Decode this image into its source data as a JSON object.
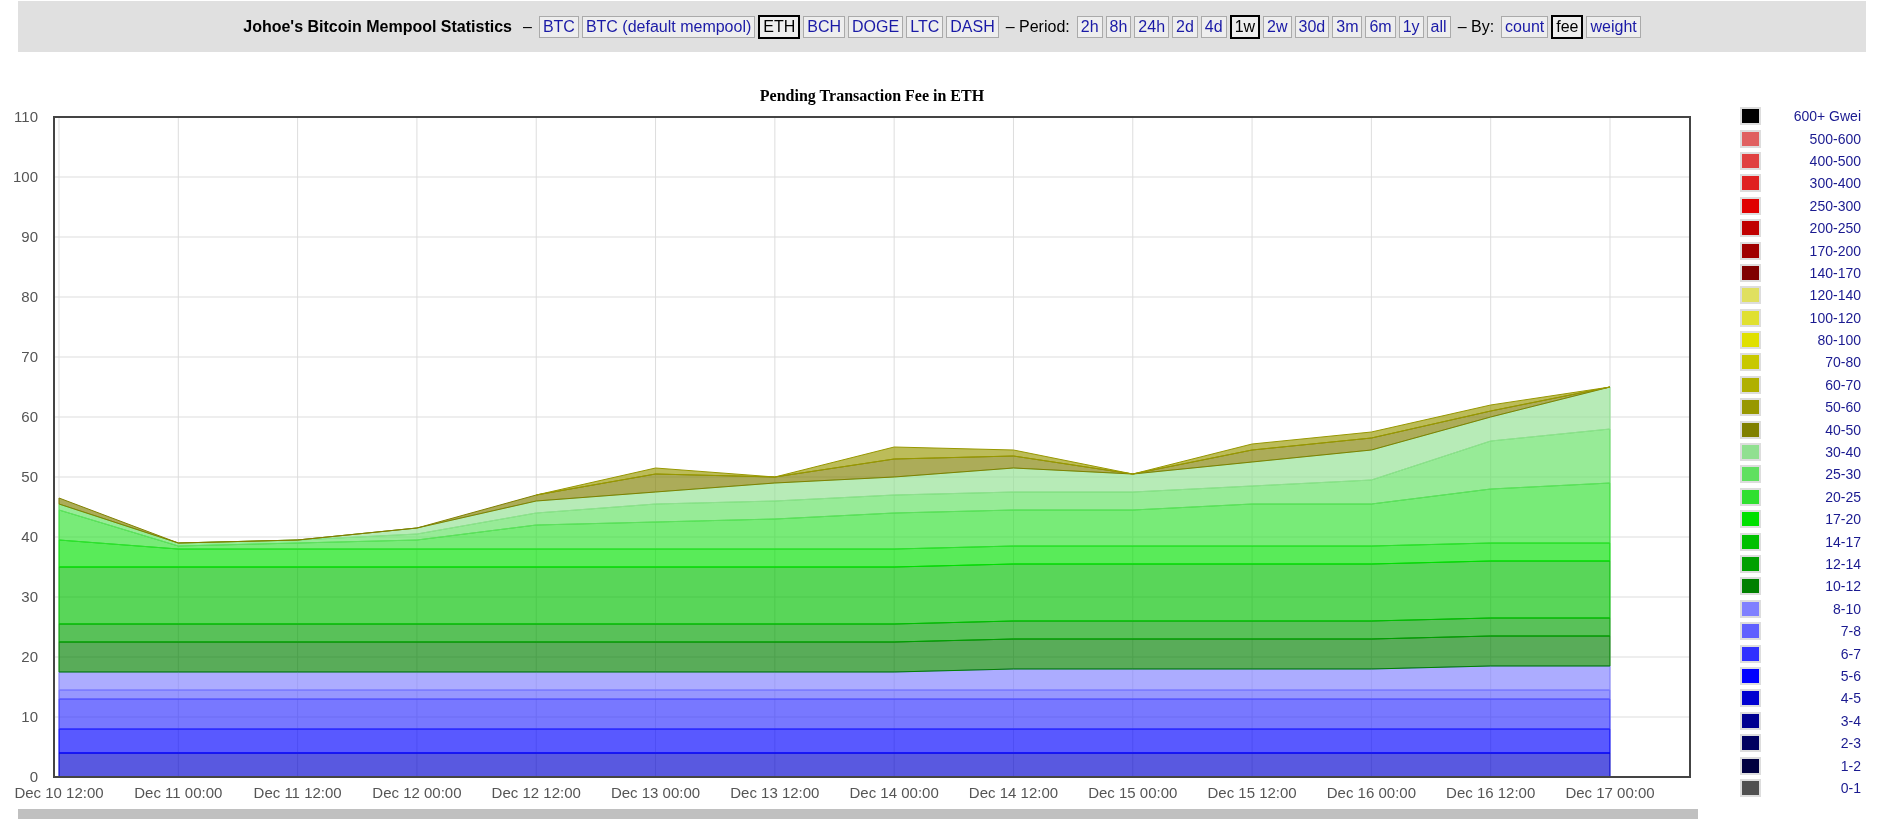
{
  "header": {
    "title": "Johoe's Bitcoin Mempool Statistics",
    "title_separator": "–",
    "coins": [
      {
        "label": "BTC",
        "selected": false
      },
      {
        "label": "BTC (default mempool)",
        "selected": false
      },
      {
        "label": "ETH",
        "selected": true
      },
      {
        "label": "BCH",
        "selected": false
      },
      {
        "label": "DOGE",
        "selected": false
      },
      {
        "label": "LTC",
        "selected": false
      },
      {
        "label": "DASH",
        "selected": false
      }
    ],
    "period_label": "– Period:",
    "periods": [
      {
        "label": "2h",
        "selected": false
      },
      {
        "label": "8h",
        "selected": false
      },
      {
        "label": "24h",
        "selected": false
      },
      {
        "label": "2d",
        "selected": false
      },
      {
        "label": "4d",
        "selected": false
      },
      {
        "label": "1w",
        "selected": true
      },
      {
        "label": "2w",
        "selected": false
      },
      {
        "label": "30d",
        "selected": false
      },
      {
        "label": "3m",
        "selected": false
      },
      {
        "label": "6m",
        "selected": false
      },
      {
        "label": "1y",
        "selected": false
      },
      {
        "label": "all",
        "selected": false
      }
    ],
    "by_label": "– By:",
    "by": [
      {
        "label": "count",
        "selected": false
      },
      {
        "label": "fee",
        "selected": true
      },
      {
        "label": "weight",
        "selected": false
      }
    ]
  },
  "chart": {
    "chart_data": {
      "type": "area",
      "stacked": true,
      "grid": true,
      "title": "Pending Transaction Fee in ETH",
      "categories": [
        "Dec 10 12:00",
        "Dec 11 00:00",
        "Dec 11 12:00",
        "Dec 12 00:00",
        "Dec 12 12:00",
        "Dec 13 00:00",
        "Dec 13 12:00",
        "Dec 14 00:00",
        "Dec 14 12:00",
        "Dec 15 00:00",
        "Dec 15 12:00",
        "Dec 16 00:00",
        "Dec 16 12:00",
        "Dec 17 00:00"
      ],
      "ylim": [
        0,
        110
      ],
      "yticks": [
        0,
        10,
        20,
        30,
        40,
        50,
        60,
        70,
        80,
        90,
        100,
        110
      ],
      "series": [
        {
          "name": "600+ Gwei",
          "color": "#000000",
          "values": [
            null,
            null,
            null,
            null,
            null,
            null,
            null,
            null,
            null,
            null,
            null,
            null,
            null,
            null
          ]
        },
        {
          "name": "500-600",
          "color": "#e06060",
          "values": [
            null,
            null,
            null,
            null,
            null,
            null,
            null,
            null,
            null,
            null,
            null,
            null,
            null,
            null
          ]
        },
        {
          "name": "400-500",
          "color": "#e04040",
          "values": [
            null,
            null,
            null,
            null,
            null,
            null,
            null,
            null,
            null,
            null,
            null,
            null,
            null,
            null
          ]
        },
        {
          "name": "300-400",
          "color": "#e02020",
          "values": [
            null,
            null,
            null,
            null,
            null,
            null,
            null,
            null,
            null,
            null,
            null,
            null,
            null,
            null
          ]
        },
        {
          "name": "250-300",
          "color": "#e00000",
          "values": [
            null,
            null,
            null,
            null,
            null,
            null,
            null,
            null,
            null,
            null,
            null,
            null,
            null,
            null
          ]
        },
        {
          "name": "200-250",
          "color": "#c00000",
          "values": [
            null,
            null,
            null,
            null,
            null,
            null,
            null,
            null,
            null,
            null,
            null,
            null,
            null,
            null
          ]
        },
        {
          "name": "170-200",
          "color": "#a00000",
          "values": [
            null,
            null,
            null,
            null,
            null,
            null,
            null,
            null,
            null,
            null,
            null,
            null,
            null,
            null
          ]
        },
        {
          "name": "140-170",
          "color": "#800000",
          "values": [
            null,
            null,
            null,
            null,
            null,
            null,
            null,
            null,
            null,
            null,
            null,
            null,
            null,
            null
          ]
        },
        {
          "name": "120-140",
          "color": "#e0e060",
          "values": [
            null,
            null,
            null,
            null,
            null,
            null,
            null,
            null,
            null,
            null,
            null,
            null,
            null,
            null
          ]
        },
        {
          "name": "100-120",
          "color": "#e0e030",
          "values": [
            null,
            null,
            null,
            null,
            null,
            null,
            null,
            null,
            null,
            null,
            null,
            null,
            null,
            null
          ]
        },
        {
          "name": "80-100",
          "color": "#e0e000",
          "values": [
            null,
            null,
            null,
            null,
            null,
            null,
            null,
            null,
            null,
            null,
            null,
            null,
            null,
            null
          ]
        },
        {
          "name": "70-80",
          "color": "#c8c800",
          "values": [
            null,
            null,
            null,
            null,
            null,
            null,
            null,
            null,
            null,
            null,
            null,
            null,
            null,
            null
          ]
        },
        {
          "name": "60-70",
          "color": "#b0b000",
          "values": [
            null,
            null,
            null,
            null,
            null,
            null,
            null,
            null,
            null,
            null,
            null,
            null,
            null,
            null
          ]
        },
        {
          "name": "50-60",
          "color": "#989800",
          "values": [
            null,
            null,
            null,
            null,
            0,
            1,
            0,
            2,
            1,
            0,
            1,
            1,
            1,
            0
          ]
        },
        {
          "name": "40-50",
          "color": "#808000",
          "values": [
            1,
            0,
            0,
            0,
            1,
            3,
            1,
            3,
            2,
            0,
            2,
            2,
            1,
            0
          ]
        },
        {
          "name": "30-40",
          "color": "#90e090",
          "values": [
            null,
            null,
            0,
            1,
            2,
            2,
            3,
            3,
            4,
            3,
            4,
            5,
            4,
            7
          ]
        },
        {
          "name": "25-30",
          "color": "#60e060",
          "values": [
            1,
            0.5,
            0.5,
            1,
            2,
            3,
            3,
            3,
            3,
            3,
            3,
            4,
            8,
            9
          ]
        },
        {
          "name": "20-25",
          "color": "#30e030",
          "values": [
            5,
            0.5,
            1,
            1.5,
            4,
            4.5,
            5,
            6,
            6,
            6,
            7,
            7,
            9,
            10
          ]
        },
        {
          "name": "17-20",
          "color": "#00e000",
          "values": [
            4.5,
            3,
            3,
            3,
            3,
            3,
            3,
            3,
            3,
            3,
            3,
            3,
            3,
            3
          ]
        },
        {
          "name": "14-17",
          "color": "#00c000",
          "values": [
            9.5,
            9.5,
            9.5,
            9.5,
            9.5,
            9.5,
            9.5,
            9.5,
            9.5,
            9.5,
            9.5,
            9.5,
            9.5,
            9.5
          ]
        },
        {
          "name": "12-14",
          "color": "#00a000",
          "values": [
            3,
            3,
            3,
            3,
            3,
            3,
            3,
            3,
            3,
            3,
            3,
            3,
            3,
            3
          ]
        },
        {
          "name": "10-12",
          "color": "#008000",
          "values": [
            5,
            5,
            5,
            5,
            5,
            5,
            5,
            5,
            5,
            5,
            5,
            5,
            5,
            5
          ]
        },
        {
          "name": "8-10",
          "color": "#8080ff",
          "values": [
            3,
            3,
            3,
            3,
            3,
            3,
            3,
            3,
            3.5,
            3.5,
            3.5,
            3.5,
            4,
            4
          ]
        },
        {
          "name": "7-8",
          "color": "#6060ff",
          "values": [
            1.5,
            1.5,
            1.5,
            1.5,
            1.5,
            1.5,
            1.5,
            1.5,
            1.5,
            1.5,
            1.5,
            1.5,
            1.5,
            1.5
          ]
        },
        {
          "name": "6-7",
          "color": "#3030ff",
          "values": [
            5,
            5,
            5,
            5,
            5,
            5,
            5,
            5,
            5,
            5,
            5,
            5,
            5,
            5
          ]
        },
        {
          "name": "5-6",
          "color": "#0000ff",
          "values": [
            4,
            4,
            4,
            4,
            4,
            4,
            4,
            4,
            4,
            4,
            4,
            4,
            4,
            4
          ]
        },
        {
          "name": "4-5",
          "color": "#0000d0",
          "values": [
            4,
            4,
            4,
            4,
            4,
            4,
            4,
            4,
            4,
            4,
            4,
            4,
            4,
            4
          ]
        },
        {
          "name": "3-4",
          "color": "#000090",
          "values": [
            null,
            null,
            null,
            null,
            null,
            null,
            null,
            null,
            null,
            null,
            null,
            null,
            null,
            null
          ]
        },
        {
          "name": "2-3",
          "color": "#000060",
          "values": [
            null,
            null,
            null,
            null,
            null,
            null,
            null,
            null,
            null,
            null,
            null,
            null,
            null,
            null
          ]
        },
        {
          "name": "1-2",
          "color": "#000040",
          "values": [
            null,
            null,
            null,
            null,
            null,
            null,
            null,
            null,
            null,
            null,
            null,
            null,
            null,
            null
          ]
        },
        {
          "name": "0-1",
          "color": "#505050",
          "values": [
            null,
            null,
            null,
            null,
            null,
            null,
            null,
            null,
            null,
            null,
            null,
            null,
            null,
            null
          ]
        }
      ]
    }
  }
}
